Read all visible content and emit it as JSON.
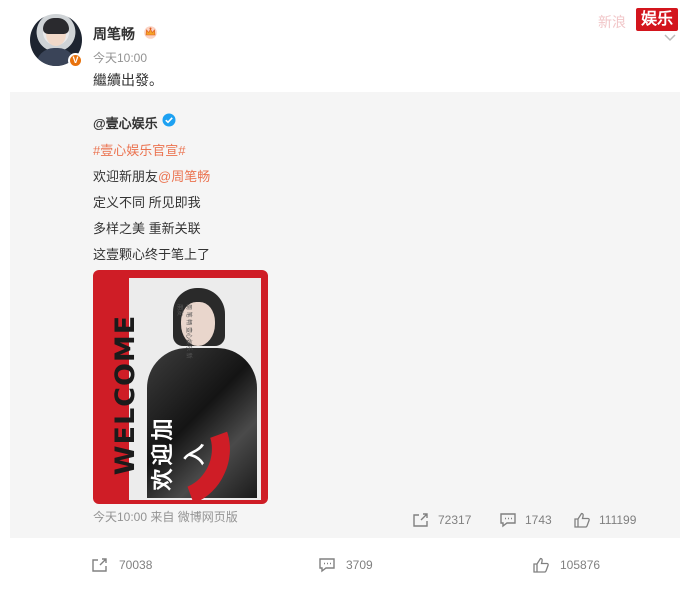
{
  "post": {
    "author": "周笔畅",
    "time": "今天10:00",
    "text": "繼續出發。",
    "verify_badge": "V",
    "watermark": "娱乐",
    "watermark_faint": "新浪",
    "actions": {
      "repost_count": "70038",
      "comment_count": "3709",
      "like_count": "105876"
    }
  },
  "retweet": {
    "author": "@壹心娱乐",
    "lines": [
      "#壹心娱乐官宣#",
      "欢迎新朋友",
      "@周笔畅",
      "定义不同 所见即我",
      "多样之美 重新关联",
      "这壹颗心终于笔上了"
    ],
    "poster": {
      "welcome": "WELCOME",
      "join": "欢迎加入",
      "small_text": "周 笔 畅 壹心娱乐 新朋友"
    },
    "meta": "今天10:00 来自 微博网页版",
    "actions": {
      "repost_count": "72317",
      "comment_count": "1743",
      "like_count": "111199"
    }
  },
  "icons": {
    "crown": "crown-icon",
    "verify": "verified-blue-icon",
    "repost": "repost-icon",
    "comment": "comment-icon",
    "like": "thumbs-up-icon",
    "more": "chevron-down-icon"
  },
  "colors": {
    "link": "#eb7350",
    "watermark_bg": "#d3151d",
    "verify_blue": "#1da1f2",
    "vip_orange": "#e8720c"
  }
}
